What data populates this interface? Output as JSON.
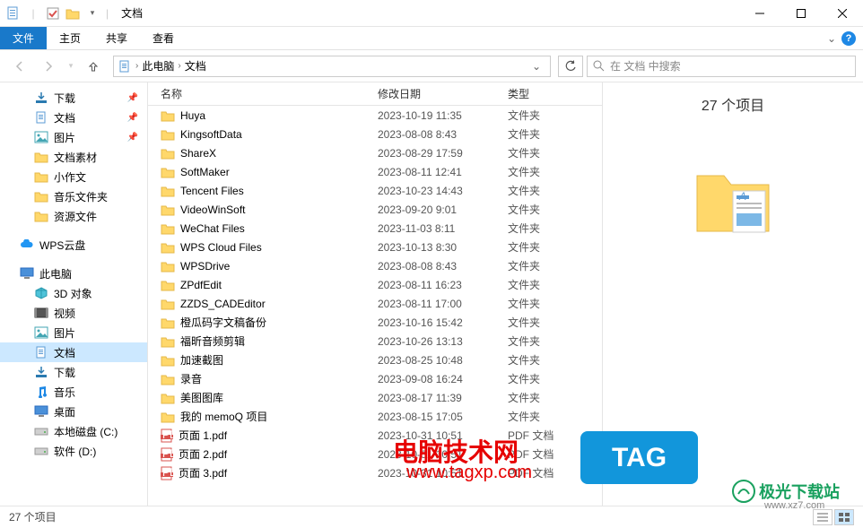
{
  "window": {
    "title": "文档"
  },
  "ribbon": {
    "file": "文件",
    "tabs": [
      "主页",
      "共享",
      "查看"
    ]
  },
  "breadcrumb": [
    "此电脑",
    "文档"
  ],
  "search": {
    "placeholder": "在 文档 中搜索"
  },
  "sidebar": {
    "quick": [
      {
        "label": "下载",
        "icon": "download",
        "pinned": true
      },
      {
        "label": "文档",
        "icon": "doc",
        "pinned": true
      },
      {
        "label": "图片",
        "icon": "pic",
        "pinned": true
      },
      {
        "label": "文档素材",
        "icon": "folder",
        "pinned": false
      },
      {
        "label": "小作文",
        "icon": "folder",
        "pinned": false
      },
      {
        "label": "音乐文件夹",
        "icon": "folder",
        "pinned": false
      },
      {
        "label": "资源文件",
        "icon": "folder",
        "pinned": false
      }
    ],
    "wps": {
      "label": "WPS云盘"
    },
    "pc": {
      "label": "此电脑"
    },
    "pc_items": [
      {
        "label": "3D 对象",
        "icon": "3d"
      },
      {
        "label": "视频",
        "icon": "video"
      },
      {
        "label": "图片",
        "icon": "pic"
      },
      {
        "label": "文档",
        "icon": "doc",
        "selected": true
      },
      {
        "label": "下载",
        "icon": "download"
      },
      {
        "label": "音乐",
        "icon": "music"
      },
      {
        "label": "桌面",
        "icon": "desktop"
      },
      {
        "label": "本地磁盘 (C:)",
        "icon": "drive"
      },
      {
        "label": "软件 (D:)",
        "icon": "drive"
      }
    ]
  },
  "columns": {
    "name": "名称",
    "date": "修改日期",
    "type": "类型"
  },
  "files": [
    {
      "name": "Huya",
      "date": "2023-10-19 11:35",
      "type": "文件夹",
      "icon": "folder"
    },
    {
      "name": "KingsoftData",
      "date": "2023-08-08 8:43",
      "type": "文件夹",
      "icon": "folder"
    },
    {
      "name": "ShareX",
      "date": "2023-08-29 17:59",
      "type": "文件夹",
      "icon": "folder"
    },
    {
      "name": "SoftMaker",
      "date": "2023-08-11 12:41",
      "type": "文件夹",
      "icon": "folder"
    },
    {
      "name": "Tencent Files",
      "date": "2023-10-23 14:43",
      "type": "文件夹",
      "icon": "folder"
    },
    {
      "name": "VideoWinSoft",
      "date": "2023-09-20 9:01",
      "type": "文件夹",
      "icon": "folder"
    },
    {
      "name": "WeChat Files",
      "date": "2023-11-03 8:11",
      "type": "文件夹",
      "icon": "folder"
    },
    {
      "name": "WPS Cloud Files",
      "date": "2023-10-13 8:30",
      "type": "文件夹",
      "icon": "folder"
    },
    {
      "name": "WPSDrive",
      "date": "2023-08-08 8:43",
      "type": "文件夹",
      "icon": "folder"
    },
    {
      "name": "ZPdfEdit",
      "date": "2023-08-11 16:23",
      "type": "文件夹",
      "icon": "folder"
    },
    {
      "name": "ZZDS_CADEditor",
      "date": "2023-08-11 17:00",
      "type": "文件夹",
      "icon": "folder"
    },
    {
      "name": "橙瓜码字文稿备份",
      "date": "2023-10-16 15:42",
      "type": "文件夹",
      "icon": "folder"
    },
    {
      "name": "福昕音频剪辑",
      "date": "2023-10-26 13:13",
      "type": "文件夹",
      "icon": "folder"
    },
    {
      "name": "加速截图",
      "date": "2023-08-25 10:48",
      "type": "文件夹",
      "icon": "folder"
    },
    {
      "name": "录音",
      "date": "2023-09-08 16:24",
      "type": "文件夹",
      "icon": "folder"
    },
    {
      "name": "美图图库",
      "date": "2023-08-17 11:39",
      "type": "文件夹",
      "icon": "folder"
    },
    {
      "name": "我的 memoQ 项目",
      "date": "2023-08-15 17:05",
      "type": "文件夹",
      "icon": "folder"
    },
    {
      "name": "页面 1.pdf",
      "date": "2023-10-31 10:51",
      "type": "PDF 文档",
      "icon": "pdf"
    },
    {
      "name": "页面 2.pdf",
      "date": "2023-10-31 10:51",
      "type": "PDF 文档",
      "icon": "pdf"
    },
    {
      "name": "页面 3.pdf",
      "date": "2023-10-31 10:51",
      "type": "PDF 文档",
      "icon": "pdf"
    }
  ],
  "details": {
    "title": "27 个项目"
  },
  "status": {
    "count": "27 个项目"
  },
  "overlays": {
    "red": "电脑技术网",
    "url": "www.tagxp.com",
    "tag": "TAG",
    "jg": "极光下载站",
    "jgurl": "www.xz7.com"
  }
}
